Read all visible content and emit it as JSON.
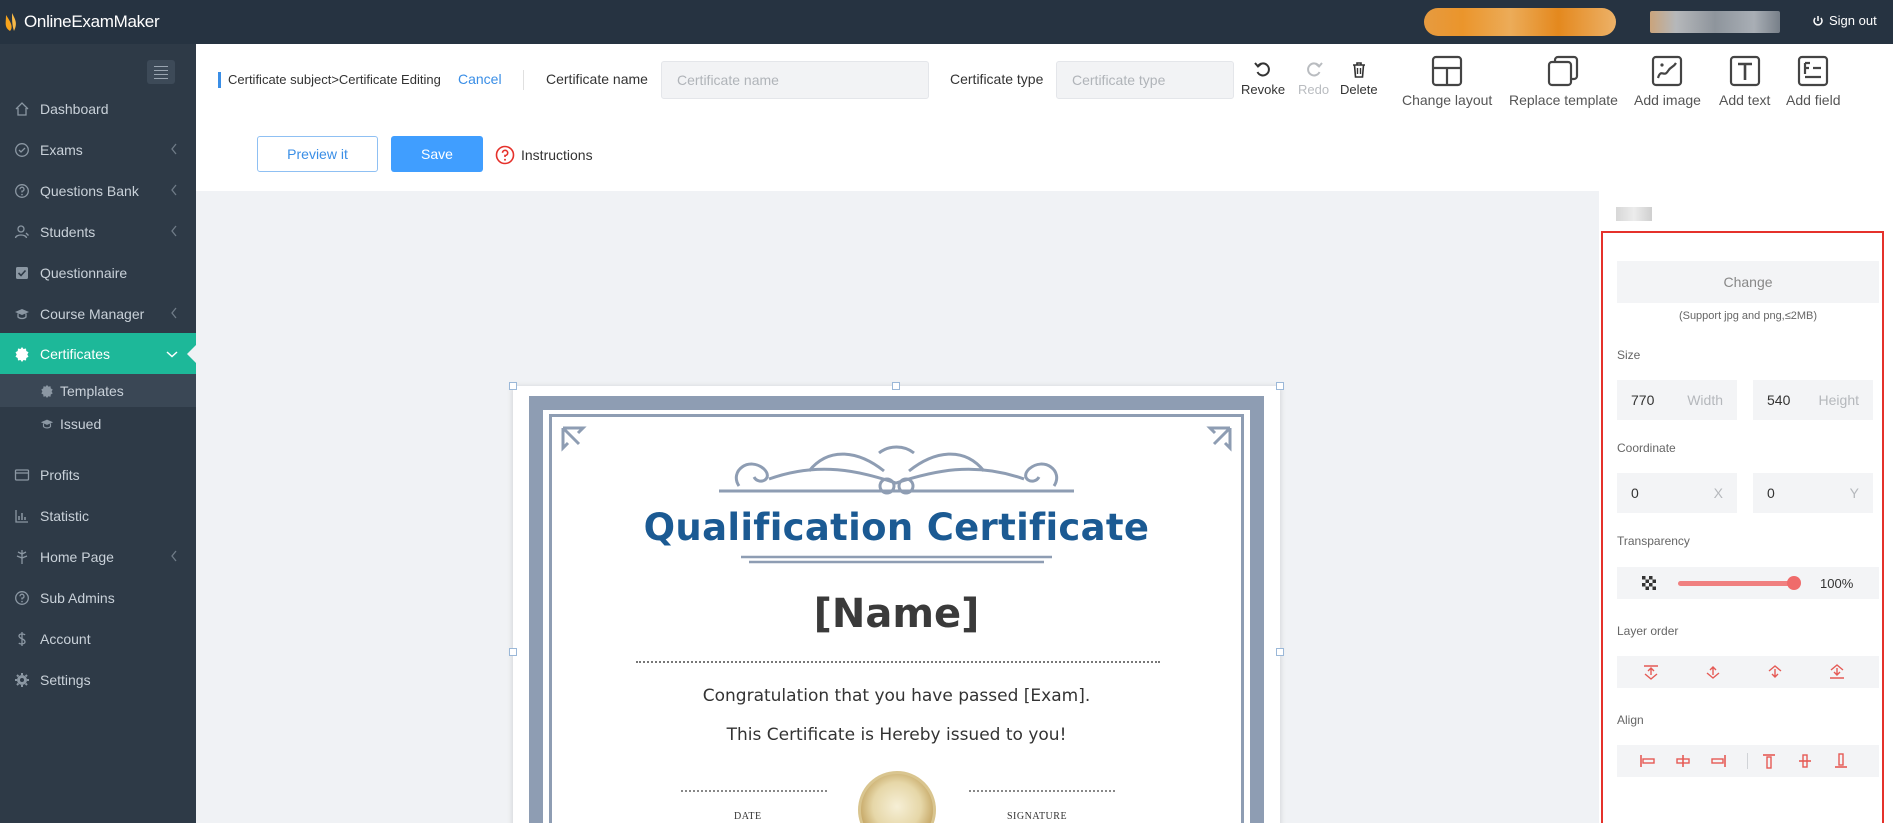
{
  "app": {
    "name": "OnlineExamMaker"
  },
  "topbar": {
    "signout_label": "Sign out"
  },
  "sidebar": {
    "items": [
      {
        "label": "Dashboard",
        "icon": "home-icon"
      },
      {
        "label": "Exams",
        "icon": "check-circle-icon"
      },
      {
        "label": "Questions Bank",
        "icon": "question-circle-icon"
      },
      {
        "label": "Students",
        "icon": "user-icon"
      },
      {
        "label": "Questionnaire",
        "icon": "checkbox-icon"
      },
      {
        "label": "Course Manager",
        "icon": "graduation-cap-icon"
      },
      {
        "label": "Certificates",
        "icon": "badge-icon"
      },
      {
        "label": "Profits",
        "icon": "wallet-icon"
      },
      {
        "label": "Statistic",
        "icon": "bar-chart-icon"
      },
      {
        "label": "Home Page",
        "icon": "tree-icon"
      },
      {
        "label": "Sub Admins",
        "icon": "question-circle-icon"
      },
      {
        "label": "Account",
        "icon": "dollar-icon"
      },
      {
        "label": "Settings",
        "icon": "gear-icon"
      }
    ],
    "sub_items": [
      {
        "label": "Templates",
        "icon": "badge-icon"
      },
      {
        "label": "Issued",
        "icon": "graduation-cap-icon"
      }
    ]
  },
  "header": {
    "breadcrumb": "Certificate subject>Certificate Editing",
    "cancel_label": "Cancel",
    "cert_name_label": "Certificate name",
    "cert_name_placeholder": "Certificate name",
    "cert_type_label": "Certificate type",
    "cert_type_placeholder": "Certificate type",
    "revoke_label": "Revoke",
    "redo_label": "Redo",
    "delete_label": "Delete",
    "change_layout_label": "Change layout",
    "replace_template_label": "Replace template",
    "add_image_label": "Add image",
    "add_text_label": "Add text",
    "add_field_label": "Add field",
    "preview_label": "Preview it",
    "save_label": "Save",
    "instructions_label": "Instructions"
  },
  "certificate": {
    "title": "Qualification Certificate",
    "name_placeholder": "[Name]",
    "line1": "Congratulation that you have passed [Exam].",
    "line2": "This Certificate is Hereby issued to you!",
    "footer_left": "DATE",
    "footer_right": "SIGNATURE"
  },
  "panel": {
    "change_label": "Change",
    "support_text": "(Support jpg and png,≤2MB)",
    "size_label": "Size",
    "width_value": "770",
    "width_unit": "Width",
    "height_value": "540",
    "height_unit": "Height",
    "coordinate_label": "Coordinate",
    "x_value": "0",
    "x_unit": "X",
    "y_value": "0",
    "y_unit": "Y",
    "transparency_label": "Transparency",
    "transparency_value": "100%",
    "transparency_fraction": 1.0,
    "layer_order_label": "Layer order",
    "align_label": "Align"
  },
  "colors": {
    "topbar": "#263341",
    "sidebar": "#2e3a47",
    "active": "#1db899",
    "primary": "#409eff",
    "cert_title": "#1b5a93",
    "highlight_box": "#e5312b"
  }
}
